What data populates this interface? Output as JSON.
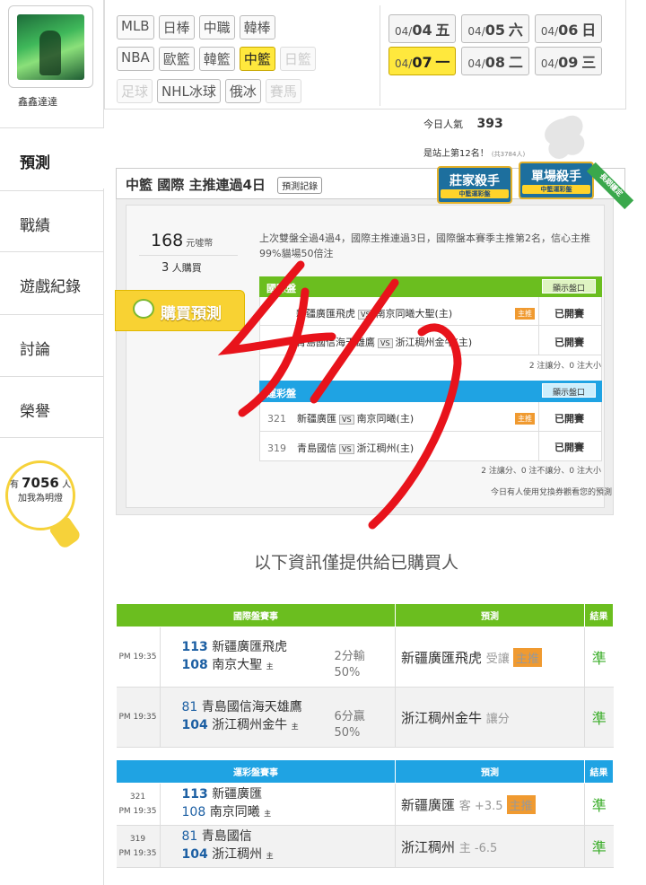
{
  "user": {
    "name": "鑫鑫達達"
  },
  "sidebar": {
    "items": [
      "預測",
      "戰績",
      "遊戲紀錄",
      "討論",
      "榮譽"
    ],
    "bulb": {
      "prefix": "有",
      "count": "7056",
      "suffix": "人",
      "line2": "加我為明燈"
    }
  },
  "sports": {
    "row1": [
      "MLB",
      "日棒",
      "中職",
      "韓棒"
    ],
    "row2": [
      "NBA",
      "歐籃",
      "韓籃",
      "中籃",
      "日籃"
    ],
    "row3": [
      "足球",
      "NHL冰球",
      "俄冰",
      "賽馬"
    ],
    "active": "中籃"
  },
  "dates": [
    {
      "md": "04/",
      "d": "04",
      "w": "五"
    },
    {
      "md": "04/",
      "d": "05",
      "w": "六"
    },
    {
      "md": "04/",
      "d": "06",
      "w": "日"
    },
    {
      "md": "04/",
      "d": "07",
      "w": "一"
    },
    {
      "md": "04/",
      "d": "08",
      "w": "二"
    },
    {
      "md": "04/",
      "d": "09",
      "w": "三"
    }
  ],
  "popularity": {
    "label": "今日人氣",
    "value": "393",
    "rank": "是站上第12名！",
    "total": "(共3784人)"
  },
  "panel": {
    "title": "中籃 國際 主推連過4日",
    "record_btn": "預測記錄",
    "badge1": "莊家殺手",
    "badge1_sub": "中籃運彩盤",
    "badge2": "單場殺手",
    "badge2_sub": "中籃運彩盤",
    "ribbon": "長期穩定",
    "price": "168",
    "price_unit": "元噓幣",
    "buyers": "3",
    "buyers_unit": "人購買",
    "buy_label": "購買預測",
    "desc": "上次雙盤全過4過4，國際主推連過3日，國際盤本賽季主推第2名，信心主推99%貓場50倍注",
    "intl": {
      "header": "國際盤",
      "show_btn": "顯示盤口",
      "rows": [
        {
          "away": "新疆廣匯飛虎",
          "home": "南京同曦大聖(主)",
          "status": "已開賽"
        },
        {
          "away": "青島國信海天雄鷹",
          "home": "浙江稠州金牛(主)",
          "status": "已開賽"
        }
      ],
      "footer": "2 注讓分、0 注大小"
    },
    "sport": {
      "header": "運彩盤",
      "show_btn": "顯示盤口",
      "rows": [
        {
          "no": "321",
          "away": "新疆廣匯",
          "home": "南京同曦(主)",
          "status": "已開賽"
        },
        {
          "no": "319",
          "away": "青島國信",
          "home": "浙江稠州(主)",
          "status": "已開賽"
        }
      ],
      "footer": "2 注讓分、0 注不讓分、0 注大小",
      "note": "今日有人使用兌換券觀看您的預測"
    }
  },
  "purchased_note": "以下資訊僅提供給已購買人",
  "table_intl": {
    "headers": [
      "國際盤賽事",
      "預測",
      "結果"
    ],
    "rows": [
      {
        "time": "PM 19:35",
        "s1": "113",
        "t1": "新疆廣匯飛虎",
        "s2": "108",
        "t2": "南京大聖",
        "margin": "2分輸",
        "pct": "50%",
        "pick": "新疆廣匯飛虎",
        "pick_note": "受讓",
        "result": "準"
      },
      {
        "time": "PM 19:35",
        "s1": "81",
        "t1": "青島國信海天雄鷹",
        "s2": "104",
        "t2": "浙江稠州金牛",
        "margin": "6分贏",
        "pct": "50%",
        "pick": "浙江稠州金牛",
        "pick_note": "讓分",
        "result": "準"
      }
    ]
  },
  "table_sport": {
    "headers": [
      "運彩盤賽事",
      "預測",
      "結果"
    ],
    "rows": [
      {
        "no": "321",
        "time": "PM 19:35",
        "s1": "113",
        "t1": "新疆廣匯",
        "s2": "108",
        "t2": "南京同曦",
        "pick": "新疆廣匯",
        "pick_note": "客 +3.5",
        "result": "準"
      },
      {
        "no": "319",
        "time": "PM 19:35",
        "s1": "81",
        "t1": "青島國信",
        "s2": "104",
        "t2": "浙江稠州",
        "pick": "浙江稠州",
        "pick_note": "主 -6.5",
        "result": "準"
      }
    ]
  },
  "zhu_label": "主推",
  "home_mark": "主",
  "handwriting": "4/7"
}
